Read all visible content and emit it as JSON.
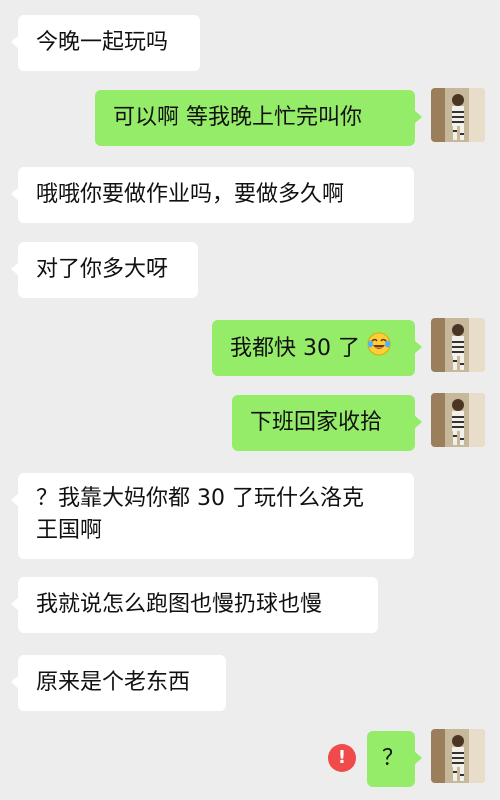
{
  "theme": {
    "background": "#ededed",
    "incoming_bubble": "#ffffff",
    "outgoing_bubble": "#95ec69",
    "error_badge": "#f04a4a"
  },
  "messages": [
    {
      "side": "in",
      "text": "今晚一起玩吗"
    },
    {
      "side": "out",
      "text": "可以啊 等我晚上忙完叫你"
    },
    {
      "side": "in",
      "text": "哦哦你要做作业吗，要做多久啊"
    },
    {
      "side": "in",
      "text": "对了你多大呀"
    },
    {
      "side": "out",
      "text": "我都快 30 了",
      "emoji": "laughing-crying-emoji"
    },
    {
      "side": "out",
      "text": "下班回家收拾"
    },
    {
      "side": "in",
      "line1": "？我靠大妈你都 30 了玩什么洛克",
      "line2": "王国啊"
    },
    {
      "side": "in",
      "text": "我就说怎么跑图也慢扔球也慢"
    },
    {
      "side": "in",
      "text": "原来是个老东西"
    },
    {
      "side": "out",
      "text": "？",
      "error_icon": "exclamation-icon",
      "error_symbol": "!"
    }
  ]
}
